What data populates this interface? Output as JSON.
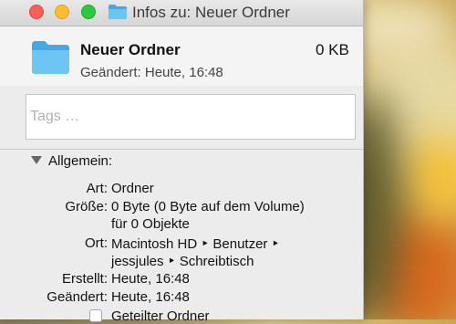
{
  "window": {
    "title": "Infos zu: Neuer Ordner",
    "title_icon": "folder-icon"
  },
  "header": {
    "name": "Neuer Ordner",
    "size": "0 KB",
    "modified": "Geändert: Heute, 16:48",
    "icon": "folder-icon"
  },
  "tags": {
    "placeholder": "Tags …",
    "value": ""
  },
  "general": {
    "section_title": "Allgemein:",
    "kind_label": "Art:",
    "kind_value": "Ordner",
    "size_label": "Größe:",
    "size_value_1": "0 Byte (0 Byte auf dem Volume)",
    "size_value_2": "für 0 Objekte",
    "where_label": "Ort:",
    "where_value_1": "Macintosh HD ‣ Benutzer ‣",
    "where_value_2": "jessjules ‣ Schreibtisch",
    "created_label": "Erstellt:",
    "created_value": "Heute, 16:48",
    "modified_label": "Geändert:",
    "modified_value": "Heute, 16:48",
    "shared_folder_label": "Geteilter Ordner",
    "shared_folder_checked": false
  },
  "colors": {
    "folder_blue": "#5bb8ec",
    "close": "#fd5f57",
    "minimize": "#febd2e",
    "maximize": "#28c940"
  }
}
